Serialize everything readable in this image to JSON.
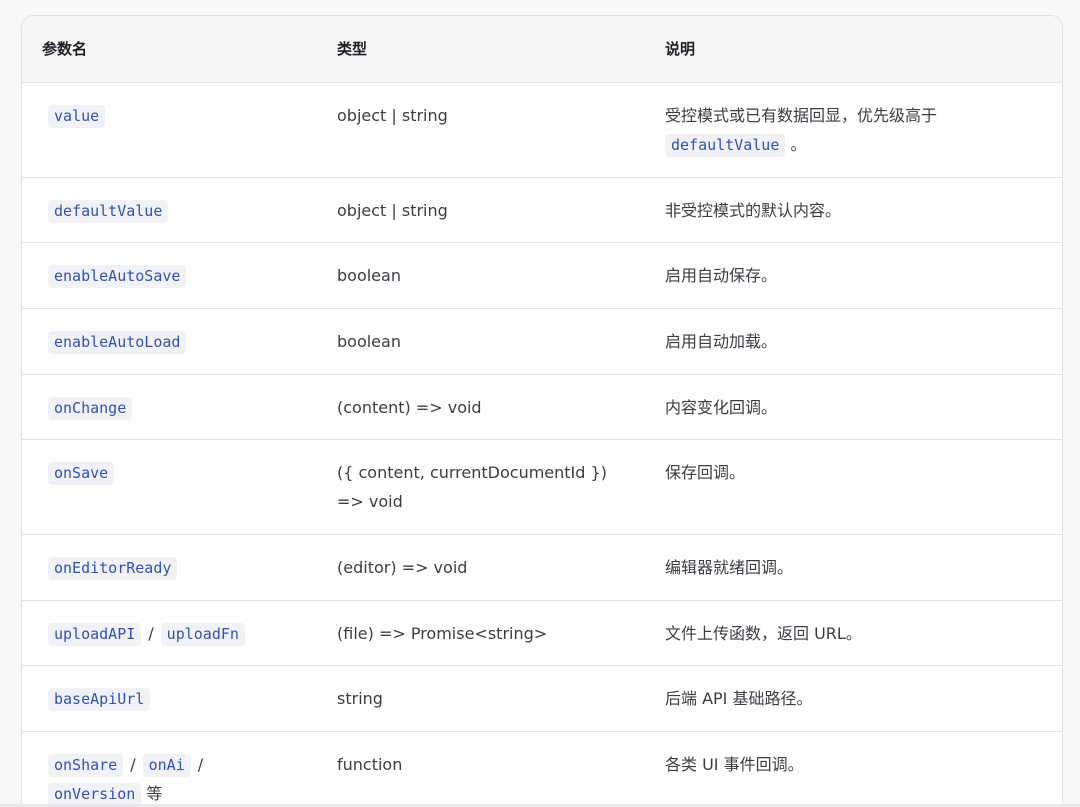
{
  "headers": {
    "name": "参数名",
    "type": "类型",
    "desc": "说明"
  },
  "rows": [
    {
      "name": "value",
      "type": "object | string",
      "desc_pre": "受控模式或已有数据回显，优先级高于 ",
      "desc_code": "defaultValue",
      "desc_post": " 。"
    },
    {
      "name": "defaultValue",
      "type": "object | string",
      "desc": "非受控模式的默认内容。"
    },
    {
      "name": "enableAutoSave",
      "type": "boolean",
      "desc": "启用自动保存。"
    },
    {
      "name": "enableAutoLoad",
      "type": "boolean",
      "desc": "启用自动加载。"
    },
    {
      "name": "onChange",
      "type": "(content) => void",
      "desc": "内容变化回调。"
    },
    {
      "name": "onSave",
      "type": "({ content, currentDocumentId }) => void",
      "desc": "保存回调。"
    },
    {
      "name": "onEditorReady",
      "type": "(editor) => void",
      "desc": "编辑器就绪回调。"
    },
    {
      "name": "uploadAPI",
      "name2": "uploadFn",
      "separator": "/",
      "type": "(file) => Promise<string>",
      "desc": "文件上传函数，返回 URL。"
    },
    {
      "name": "baseApiUrl",
      "type": "string",
      "desc": "后端 API 基础路径。"
    },
    {
      "name": "onShare",
      "name2": "onAi",
      "name3": "onVersion",
      "separator": "/",
      "suffix": "等",
      "type": "function",
      "desc": "各类 UI 事件回调。"
    }
  ],
  "colors": {
    "code_text": "#3451b2",
    "code_bg": "#f1f2f5",
    "header_bg": "#f6f6f7",
    "border": "#e2e2e3"
  }
}
